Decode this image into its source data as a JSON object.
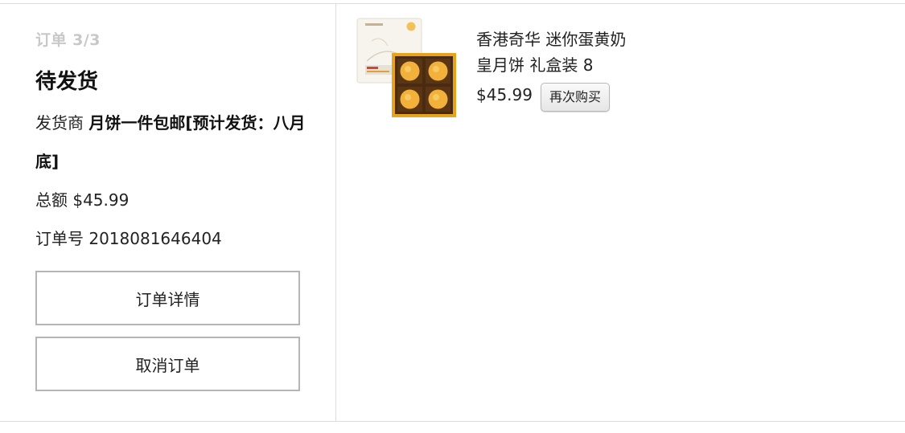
{
  "order": {
    "counter": "订单 3/3",
    "status": "待发货",
    "seller_label": "发货商",
    "seller_name": "月饼一件包邮[预计发货：八月底]",
    "total_label": "总额",
    "total_value": "$45.99",
    "order_no_label": "订单号",
    "order_no_value": "2018081646404",
    "detail_button": "订单详情",
    "cancel_button": "取消订单"
  },
  "product": {
    "title": "香港奇华 迷你蛋黄奶皇月饼 礼盒装 8",
    "price": "$45.99",
    "rebuy_button": "再次购买",
    "image_icon": "mooncake-giftbox-image"
  },
  "colors": {
    "border": "#dcdcdc",
    "button_border": "#b5b5b5",
    "counter_text": "#c8c8c8",
    "box_gold": "#e8a31c",
    "box_dark": "#4a2a10",
    "mooncake": "#f2b13a"
  }
}
